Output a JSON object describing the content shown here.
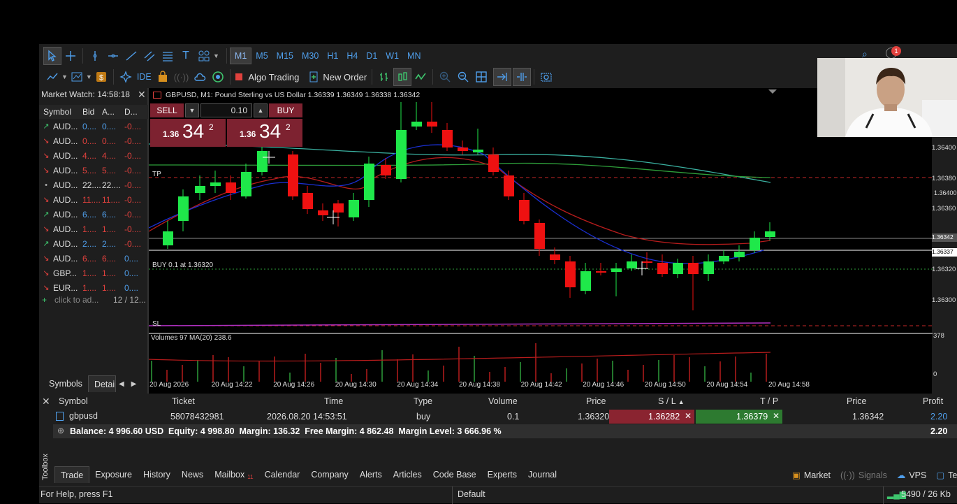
{
  "toolbar": {
    "timeframes": [
      "M1",
      "M5",
      "M15",
      "M30",
      "H1",
      "H4",
      "D1",
      "W1",
      "MN"
    ],
    "active_timeframe": "M1",
    "ide_label": "IDE",
    "algo_trading_label": "Algo Trading",
    "new_order_label": "New Order",
    "notification_count": "1"
  },
  "market_watch": {
    "title": "Market Watch: 14:58:18",
    "columns": [
      "Symbol",
      "Bid",
      "A...",
      "D..."
    ],
    "rows": [
      {
        "dir": "up",
        "symbol": "AUD...",
        "bid": "0....",
        "ask": "0....",
        "change": "-0...."
      },
      {
        "dir": "down",
        "symbol": "AUD...",
        "bid": "0....",
        "ask": "0....",
        "change": "-0...."
      },
      {
        "dir": "down",
        "symbol": "AUD...",
        "bid": "4....",
        "ask": "4....",
        "change": "-0...."
      },
      {
        "dir": "down",
        "symbol": "AUD...",
        "bid": "5....",
        "ask": "5....",
        "change": "-0...."
      },
      {
        "dir": "flat",
        "symbol": "AUD...",
        "bid": "22....",
        "ask": "22....",
        "change": "-0...."
      },
      {
        "dir": "down",
        "symbol": "AUD...",
        "bid": "11....",
        "ask": "11....",
        "change": "-0...."
      },
      {
        "dir": "up",
        "symbol": "AUD...",
        "bid": "6....",
        "ask": "6....",
        "change": "-0...."
      },
      {
        "dir": "down",
        "symbol": "AUD...",
        "bid": "1....",
        "ask": "1....",
        "change": "-0...."
      },
      {
        "dir": "up",
        "symbol": "AUD...",
        "bid": "2....",
        "ask": "2....",
        "change": "-0...."
      },
      {
        "dir": "down",
        "symbol": "AUD...",
        "bid": "6....",
        "ask": "6....",
        "change": "0...."
      },
      {
        "dir": "down",
        "symbol": "GBP...",
        "bid": "1....",
        "ask": "1....",
        "change": "0...."
      },
      {
        "dir": "down",
        "symbol": "EUR...",
        "bid": "1....",
        "ask": "1....",
        "change": "0...."
      }
    ],
    "add_symbol": "click to ad...",
    "count": "12 / 12...",
    "tabs": [
      "Symbols",
      "Detail"
    ]
  },
  "chart": {
    "title": "GBPUSD, M1: Pound Sterling vs US Dollar  1.36339 1.36349 1.36338 1.36342",
    "one_click": {
      "sell_label": "SELL",
      "buy_label": "BUY",
      "lot": "0.10",
      "sell_big": "1.36",
      "sell_pips": "34",
      "sell_frac": "2",
      "buy_big": "1.36",
      "buy_pips": "34",
      "buy_frac": "2"
    },
    "tp_label": "TP",
    "sl_label": "SL",
    "position_label": "BUY 0.1 at 1.36320",
    "price_axis": [
      "1.36400",
      "1.36380",
      "1.36360",
      "1.36320",
      "1.36300"
    ],
    "price_tags": [
      "1.36342",
      "1.36337"
    ],
    "volume_label": "Volumes 97 MA(20) 238.6",
    "volume_axis": [
      "378",
      "0"
    ],
    "time_axis": [
      "20 Aug 2026",
      "20 Aug 14:22",
      "20 Aug 14:26",
      "20 Aug 14:30",
      "20 Aug 14:34",
      "20 Aug 14:38",
      "20 Aug 14:42",
      "20 Aug 14:46",
      "20 Aug 14:50",
      "20 Aug 14:54",
      "20 Aug 14:58"
    ]
  },
  "trade": {
    "columns": [
      "Symbol",
      "Ticket",
      "Time",
      "Type",
      "Volume",
      "Price",
      "S / L",
      "T / P",
      "Price",
      "Profit"
    ],
    "position": {
      "symbol": "gbpusd",
      "ticket": "58078432981",
      "time": "2026.08.20 14:53:51",
      "type": "buy",
      "volume": "0.1",
      "price": "1.36320",
      "sl": "1.36282",
      "tp": "1.36379",
      "current": "1.36342",
      "profit": "2.20"
    },
    "summary": "Balance: 4 996.60 USD  Equity: 4 998.80  Margin: 136.32  Free Margin: 4 862.48  Margin Level: 3 666.96 %",
    "summary_profit": "2.20"
  },
  "toolbox": {
    "side_label": "Toolbox",
    "tabs": [
      "Trade",
      "Exposure",
      "History",
      "News",
      "Mailbox",
      "Calendar",
      "Company",
      "Alerts",
      "Articles",
      "Code Base",
      "Experts",
      "Journal"
    ],
    "mailbox_badge": "11",
    "right": [
      "Market",
      "Signals",
      "VPS",
      "Tester"
    ]
  },
  "status": {
    "help": "For Help, press F1",
    "profile": "Default",
    "traffic": "5490 / 26 Kb"
  },
  "colors": {
    "bull": "#1fe84a",
    "bear": "#ee1111",
    "accent": "#4f9eea"
  }
}
